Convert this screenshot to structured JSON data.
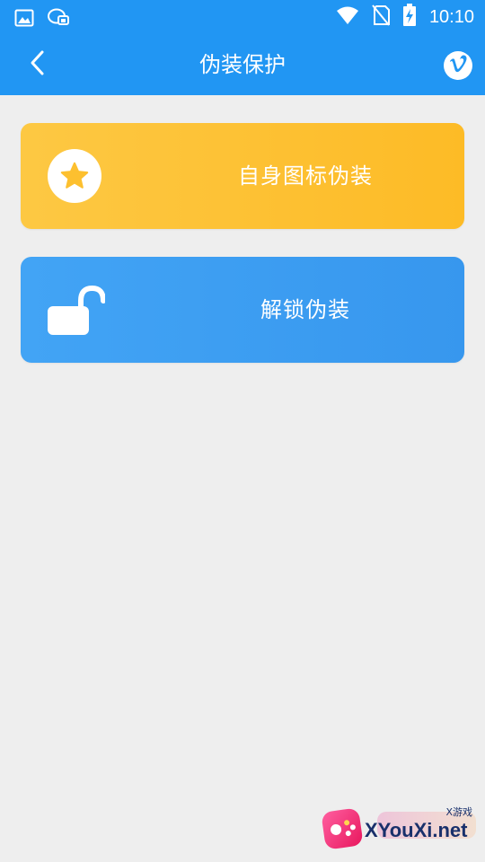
{
  "status_bar": {
    "time": "10:10",
    "icons": [
      "image-icon",
      "chat-bubbles-icon",
      "wifi-icon",
      "no-sim-icon",
      "battery-charging-icon"
    ]
  },
  "app_bar": {
    "title": "伪装保护",
    "back_icon": "chevron-left-icon",
    "action_icon": "vimeo-icon"
  },
  "options": [
    {
      "label": "自身图标伪装",
      "icon": "star-icon",
      "color": "#fdc02f"
    },
    {
      "label": "解锁伪装",
      "icon": "unlock-icon",
      "color": "#3d9ef2"
    }
  ],
  "watermark": {
    "text": "XYouXi.net",
    "sub": "X游戏"
  },
  "colors": {
    "primary": "#2196f3",
    "background": "#eeeeee"
  }
}
